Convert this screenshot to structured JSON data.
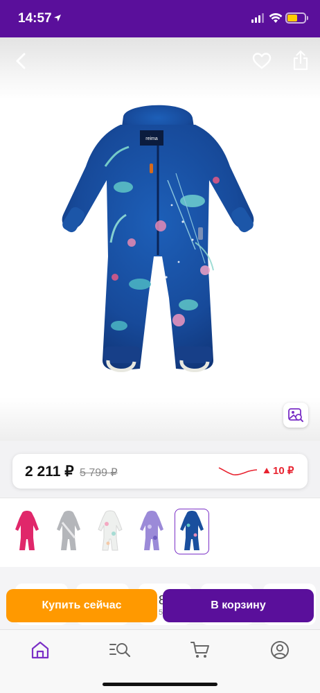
{
  "status_bar": {
    "time": "14:57"
  },
  "colors": {
    "brand": "#5a0f9b",
    "accent_orange": "#ff9900",
    "price_down": "#e8222f"
  },
  "hero": {
    "icons": [
      "back-chevron-icon",
      "heart-icon",
      "share-icon",
      "visual-search-icon"
    ],
    "brand_label": "reima"
  },
  "price": {
    "current": "2 211 ₽",
    "old": "5 799 ₽",
    "delta": "10 ₽",
    "delta_direction_icon": "triangle-up-icon"
  },
  "variants": {
    "items": [
      "pink",
      "grey",
      "white-floral",
      "lilac",
      "blue-print"
    ],
    "selected_index": 4
  },
  "below": {
    "partial_value": "8",
    "partial_sub": "56"
  },
  "actions": {
    "buy_now": "Купить сейчас",
    "add_to_cart": "В корзину"
  },
  "tabbar": {
    "tabs": [
      "home-icon",
      "catalog-search-icon",
      "cart-icon",
      "profile-icon"
    ],
    "active_index": 0
  }
}
